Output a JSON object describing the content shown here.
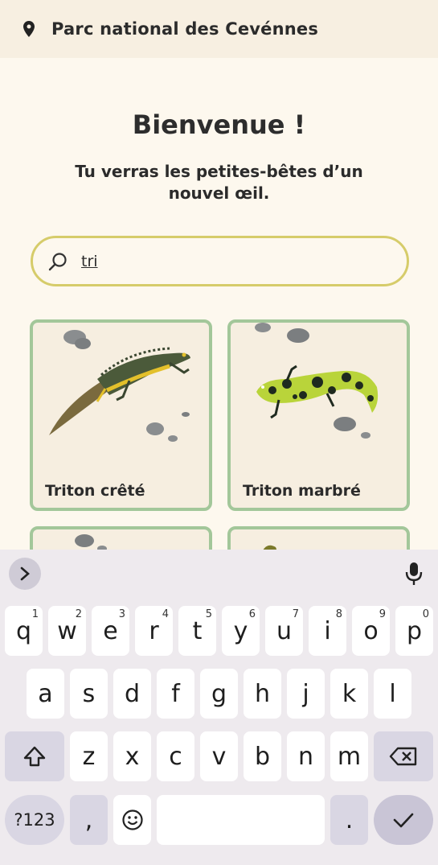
{
  "header": {
    "location": "Parc national des Cevénnes",
    "icon": "map-pin-icon"
  },
  "welcome": {
    "title": "Bienvenue !",
    "subtitle": "Tu verras les petites-bêtes d’un nouvel œil."
  },
  "search": {
    "value": "tri",
    "icon": "search-icon"
  },
  "results": [
    {
      "label": "Triton crêté"
    },
    {
      "label": "Triton marbré"
    }
  ],
  "keyboard": {
    "row1": [
      {
        "k": "q",
        "n": "1"
      },
      {
        "k": "w",
        "n": "2"
      },
      {
        "k": "e",
        "n": "3"
      },
      {
        "k": "r",
        "n": "4"
      },
      {
        "k": "t",
        "n": "5"
      },
      {
        "k": "y",
        "n": "6"
      },
      {
        "k": "u",
        "n": "7"
      },
      {
        "k": "i",
        "n": "8"
      },
      {
        "k": "o",
        "n": "9"
      },
      {
        "k": "p",
        "n": "0"
      }
    ],
    "row2": [
      "a",
      "s",
      "d",
      "f",
      "g",
      "h",
      "j",
      "k",
      "l"
    ],
    "row3": [
      "z",
      "x",
      "c",
      "v",
      "b",
      "n",
      "m"
    ],
    "symbols_label": "?123",
    "comma": ",",
    "period": "."
  }
}
